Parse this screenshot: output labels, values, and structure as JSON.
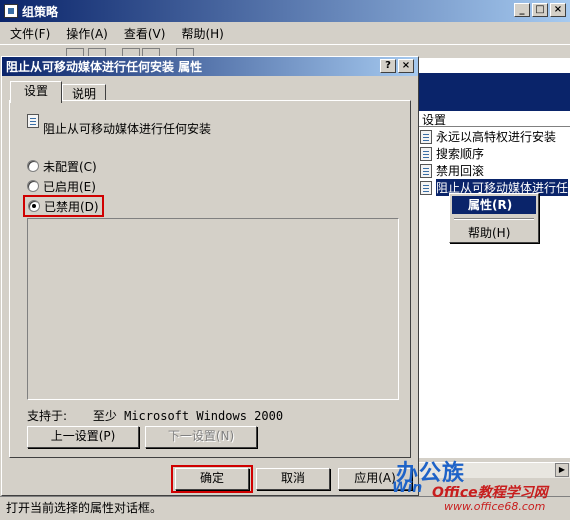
{
  "main_window": {
    "title": "组策略",
    "menu": [
      "文件(F)",
      "操作(A)",
      "查看(V)",
      "帮助(H)"
    ],
    "caption": {
      "minimize": "_",
      "maximize": "□",
      "close": "×"
    },
    "status_text": "打开当前选择的属性对话框。"
  },
  "right_pane": {
    "column_header": "设置",
    "items": [
      "永远以高特权进行安装",
      "搜索顺序",
      "禁用回滚",
      "阻止从可移动媒体进行任"
    ]
  },
  "context_menu": {
    "items": [
      "属性(R)",
      "帮助(H)"
    ]
  },
  "dialog": {
    "title": "阻止从可移动媒体进行任何安装 属性",
    "caption": {
      "help": "?",
      "close": "×"
    },
    "tabs": [
      "设置",
      "说明"
    ],
    "policy_name": "阻止从可移动媒体进行任何安装",
    "options": [
      {
        "label": "未配置(C)",
        "checked": false
      },
      {
        "label": "已启用(E)",
        "checked": false
      },
      {
        "label": "已禁用(D)",
        "checked": true
      }
    ],
    "supports_label": "支持于:",
    "supports_value": "至少 Microsoft Windows 2000",
    "prev_button": "上一设置(P)",
    "next_button": "下一设置(N)",
    "ok_button": "确定",
    "cancel_button": "取消",
    "apply_button": "应用(A)"
  },
  "watermark": {
    "logo": "办公族",
    "logo_sub": "Win",
    "site_name": "Office教程学习网",
    "url": "www.office68.com"
  }
}
